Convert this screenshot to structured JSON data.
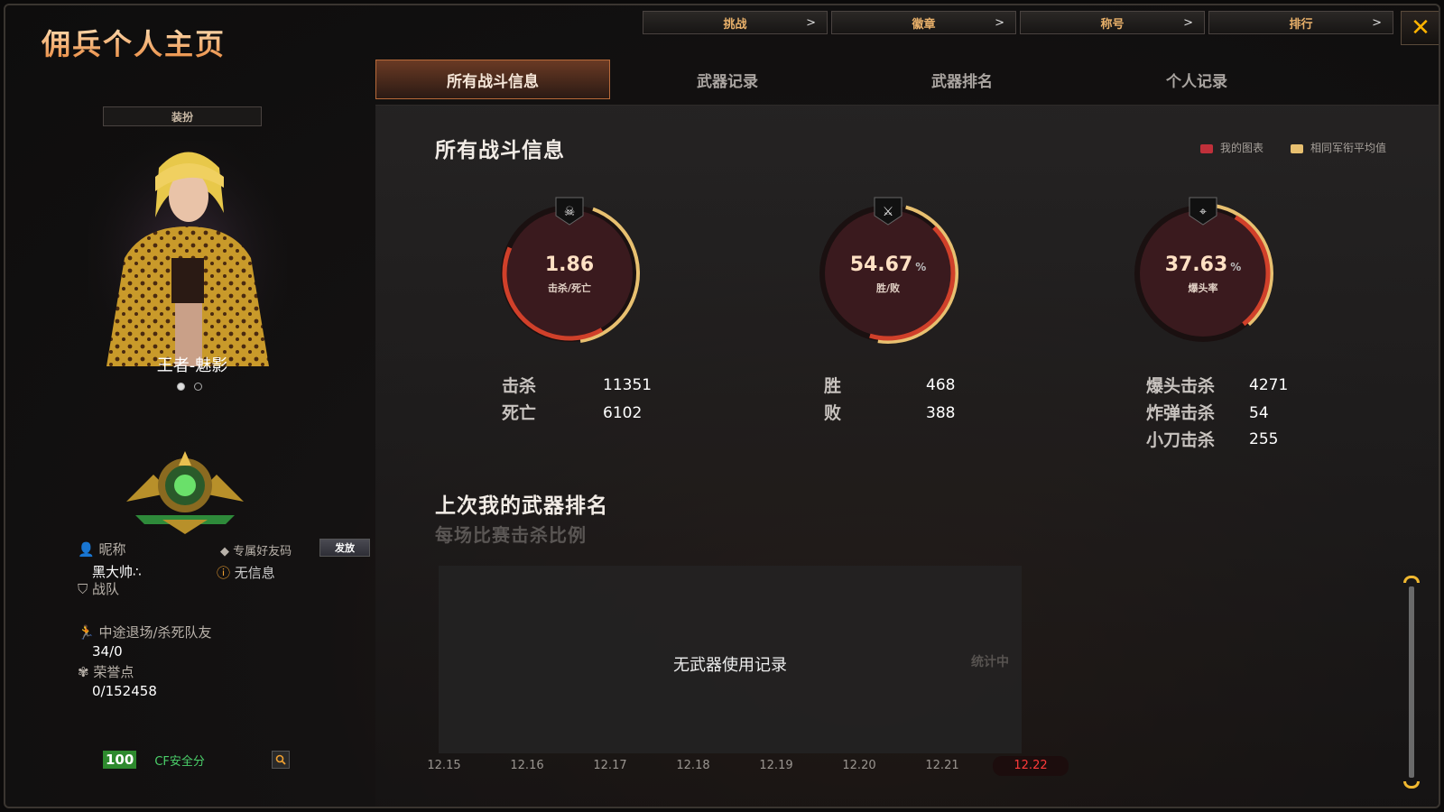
{
  "app_title": "佣兵个人主页",
  "top_nav": [
    {
      "label": "挑战",
      "chev": ">"
    },
    {
      "label": "徽章",
      "chev": ">"
    },
    {
      "label": "称号",
      "chev": ">"
    },
    {
      "label": "排行",
      "chev": ">"
    }
  ],
  "close_label": "✕",
  "tabs": [
    "所有战斗信息",
    "武器记录",
    "武器排名",
    "个人记录"
  ],
  "left": {
    "outfit_button": "装扮",
    "character_name": "王者-魅影",
    "nickname_label": "昵称",
    "nickname_value": "黑大帅∴",
    "friend_code_label": "专属好友码",
    "send_button": "发放",
    "friend_code_value": "无信息",
    "team_label": "战队",
    "leave_label": "中途退场/杀死队友",
    "leave_value": "34/0",
    "honor_label": "荣誉点",
    "honor_value": "0/152458",
    "security_score": "100",
    "security_label": "CF安全分"
  },
  "main": {
    "section_title": "所有战斗信息",
    "legend": [
      {
        "label": "我的图表",
        "color": "#c0303a"
      },
      {
        "label": "相同军衔平均值",
        "color": "#e8c070"
      }
    ],
    "gauges": [
      {
        "value": "1.86",
        "unit": "",
        "caption": "击杀/死亡"
      },
      {
        "value": "54.67",
        "unit": "%",
        "caption": "胜/败"
      },
      {
        "value": "37.63",
        "unit": "%",
        "caption": "爆头率"
      }
    ],
    "stats_kd": [
      {
        "label": "击杀",
        "value": "11351"
      },
      {
        "label": "死亡",
        "value": "6102"
      }
    ],
    "stats_wl": [
      {
        "label": "胜",
        "value": "468"
      },
      {
        "label": "败",
        "value": "388"
      }
    ],
    "stats_hs": [
      {
        "label": "爆头击杀",
        "value": "4271"
      },
      {
        "label": "炸弹击杀",
        "value": "54"
      },
      {
        "label": "小刀击杀",
        "value": "255"
      }
    ],
    "weapon_title": "上次我的武器排名",
    "weapon_subtitle": "每场比赛击杀比例",
    "weapon_empty": "无武器使用记录",
    "weapon_counting": "统计中",
    "dates": [
      "12.15",
      "12.16",
      "12.17",
      "12.18",
      "12.19",
      "12.20",
      "12.21",
      "12.22"
    ]
  }
}
